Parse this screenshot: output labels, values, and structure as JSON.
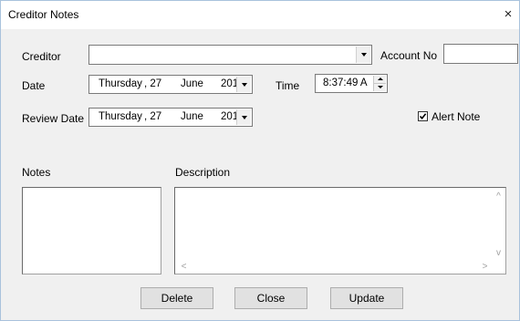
{
  "window": {
    "title": "Creditor Notes",
    "close_glyph": "×"
  },
  "form": {
    "creditor_label": "Creditor",
    "creditor_value": "",
    "account_no_label": "Account No",
    "account_no_value": "",
    "date_label": "Date",
    "date": {
      "weekday": "Thursday",
      "day": ", 27",
      "month": "June",
      "year": "201"
    },
    "time_label": "Time",
    "time_value": "8:37:49 A",
    "review_date_label": "Review Date",
    "review_date": {
      "weekday": "Thursday",
      "day": ", 27",
      "month": "June",
      "year": "201"
    },
    "alert_note_label": "Alert Note",
    "alert_note_checked": true,
    "notes_label": "Notes",
    "description_label": "Description"
  },
  "buttons": {
    "delete": "Delete",
    "close": "Close",
    "update": "Update"
  },
  "scroll_glyphs": {
    "up": "^",
    "down": "v",
    "left": "<",
    "right": ">"
  }
}
